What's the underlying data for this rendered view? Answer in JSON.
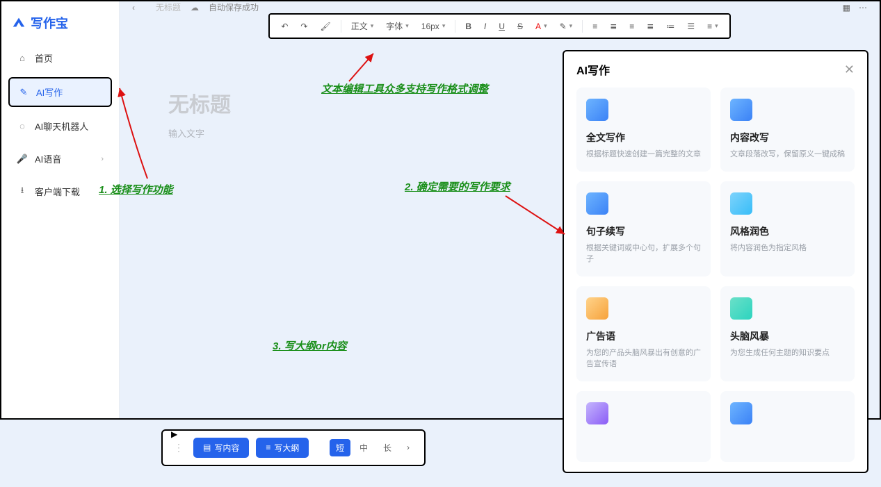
{
  "app": {
    "name": "写作宝"
  },
  "sidebar": {
    "items": [
      {
        "label": "首页"
      },
      {
        "label": "AI写作"
      },
      {
        "label": "AI聊天机器人"
      },
      {
        "label": "AI语音"
      },
      {
        "label": "客户端下载"
      }
    ]
  },
  "topbar": {
    "doc_name": "无标题",
    "autosave": "自动保存成功"
  },
  "toolbar": {
    "format": "正文",
    "font": "字体",
    "size": "16px"
  },
  "editor": {
    "title_placeholder": "无标题",
    "body_placeholder": "输入文字"
  },
  "bottom": {
    "write_content": "写内容",
    "write_outline": "写大纲",
    "seg": [
      "短",
      "中",
      "长"
    ]
  },
  "ai_panel": {
    "title": "AI写作",
    "cards": [
      {
        "title": "全文写作",
        "desc": "根据标题快速创建一篇完整的文章"
      },
      {
        "title": "内容改写",
        "desc": "文章段落改写，保留原义一键成稿"
      },
      {
        "title": "句子续写",
        "desc": "根据关键词或中心句，扩展多个句子"
      },
      {
        "title": "风格润色",
        "desc": "将内容润色为指定风格"
      },
      {
        "title": "广告语",
        "desc": "为您的产品头脑风暴出有创意的广告宣传语"
      },
      {
        "title": "头脑风暴",
        "desc": "为您生成任何主题的知识要点"
      }
    ]
  },
  "annotations": {
    "a1": "1. 选择写作功能",
    "a2": "2. 确定需要的写作要求",
    "a3": "3. 写大纲or内容",
    "a_toolbar": "文本编辑工具众多支持写作格式调整"
  }
}
